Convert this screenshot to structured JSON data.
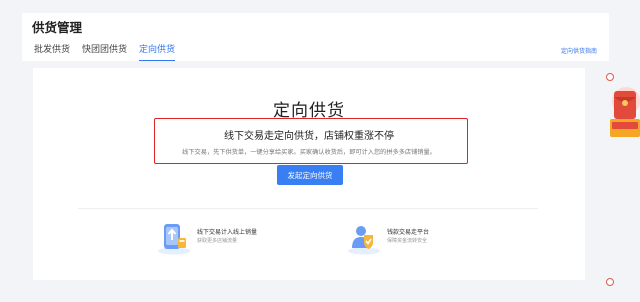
{
  "page": {
    "title": "供货管理"
  },
  "tabs": [
    {
      "label": "批发供货",
      "active": false
    },
    {
      "label": "快团团供货",
      "active": false
    },
    {
      "label": "定向供货",
      "active": true
    }
  ],
  "header": {
    "guide_link": "定向供货指南"
  },
  "main": {
    "hero_title": "定向供货",
    "headline": "线下交易走定向供货，店铺权重涨不停",
    "subline": "线下交易，先下供货单，一键分享给买家。买家确认收货后，即可计入您的拼多多店铺销量。",
    "primary_button": "发起定向供货"
  },
  "features": [
    {
      "title": "线下交易计入线上销量",
      "desc": "获取更多店铺流量",
      "icon": "sales-phone-icon"
    },
    {
      "title": "钱款交易走平台",
      "desc": "保障资金流转安全",
      "icon": "shield-safety-icon"
    }
  ],
  "floating_widget": {
    "icon": "red-envelope-promo-icon"
  },
  "colors": {
    "accent": "#3377ee",
    "button": "#3a7ef3",
    "highlight_border": "#e02424",
    "promo_red": "#e24a3b"
  }
}
